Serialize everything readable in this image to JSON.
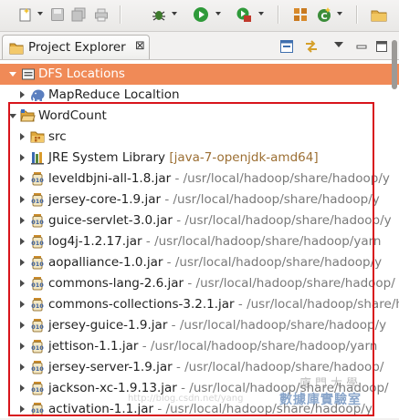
{
  "view": {
    "title": "Project Explorer",
    "close_glyph": "⊠"
  },
  "toolbar": {
    "buttons": [
      "new-icon",
      "save-icon",
      "save-all-icon",
      "print-icon",
      "debug-icon",
      "run-icon",
      "external-tools-icon",
      "new-package-icon",
      "new-class-icon",
      "open-perspective-icon"
    ]
  },
  "tree": {
    "dfs_locations": "DFS Locations",
    "mapreduce_location": "MapReduce Localtion",
    "project": "WordCount",
    "src": "src",
    "jre": {
      "label": "JRE System Library",
      "decoration": "[java-7-openjdk-amd64]"
    },
    "jars": [
      {
        "name": "leveldbjni-all-1.8.jar",
        "path": " - /usr/local/hadoop/share/hadoop/y"
      },
      {
        "name": "jersey-core-1.9.jar",
        "path": " - /usr/local/hadoop/share/hadoop/y"
      },
      {
        "name": "guice-servlet-3.0.jar",
        "path": " - /usr/local/hadoop/share/hadoop/y"
      },
      {
        "name": "log4j-1.2.17.jar",
        "path": " - /usr/local/hadoop/share/hadoop/yarn"
      },
      {
        "name": "aopalliance-1.0.jar",
        "path": " - /usr/local/hadoop/share/hadoop/y"
      },
      {
        "name": "commons-lang-2.6.jar",
        "path": " - /usr/local/hadoop/share/hadoop/"
      },
      {
        "name": "commons-collections-3.2.1.jar",
        "path": " - /usr/local/hadoop/share/ha"
      },
      {
        "name": "jersey-guice-1.9.jar",
        "path": " - /usr/local/hadoop/share/hadoop/y"
      },
      {
        "name": "jettison-1.1.jar",
        "path": " - /usr/local/hadoop/share/hadoop/yarn"
      },
      {
        "name": "jersey-server-1.9.jar",
        "path": " - /usr/local/hadoop/share/hadoop/"
      },
      {
        "name": "jackson-xc-1.9.13.jar",
        "path": " - /usr/local/hadoop/share/hadoop/"
      },
      {
        "name": "activation-1.1.jar",
        "path": " - /usr/local/hadoop/share/hadoop/y"
      }
    ]
  },
  "watermark": {
    "top": "廈門大學",
    "bottom": "數據庫實驗室",
    "url": "http://blog.csdn.net/yang"
  },
  "colors": {
    "selection": "#f08a57",
    "highlight_box": "#d8141b"
  }
}
